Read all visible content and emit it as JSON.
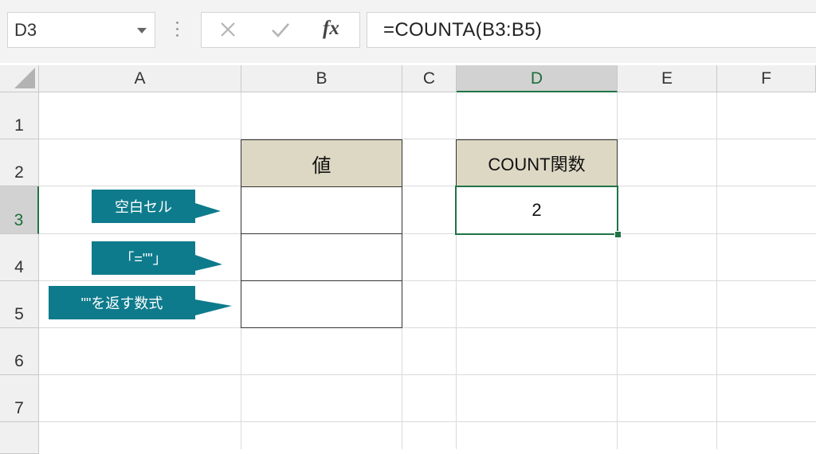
{
  "name_box": {
    "value": "D3"
  },
  "formula_bar": {
    "cancel_icon": "x-icon",
    "enter_icon": "check-icon",
    "fx_label": "fx",
    "formula": "=COUNTA(B3:B5)"
  },
  "columns": [
    {
      "label": "A"
    },
    {
      "label": "B"
    },
    {
      "label": "C"
    },
    {
      "label": "D"
    },
    {
      "label": "E"
    },
    {
      "label": "F"
    }
  ],
  "rows": [
    {
      "label": "1"
    },
    {
      "label": "2"
    },
    {
      "label": "3"
    },
    {
      "label": "4"
    },
    {
      "label": "5"
    },
    {
      "label": "6"
    },
    {
      "label": "7"
    }
  ],
  "cells": {
    "b2": "値",
    "d2": "COUNT関数",
    "d3": "2"
  },
  "callouts": [
    {
      "text": "空白セル"
    },
    {
      "text": "「=\"\"」"
    },
    {
      "text": "\"\"を返す数式"
    }
  ],
  "colors": {
    "accent": "#217346",
    "header_fill": "#ddd8c4",
    "callout": "#0e7b8c"
  }
}
